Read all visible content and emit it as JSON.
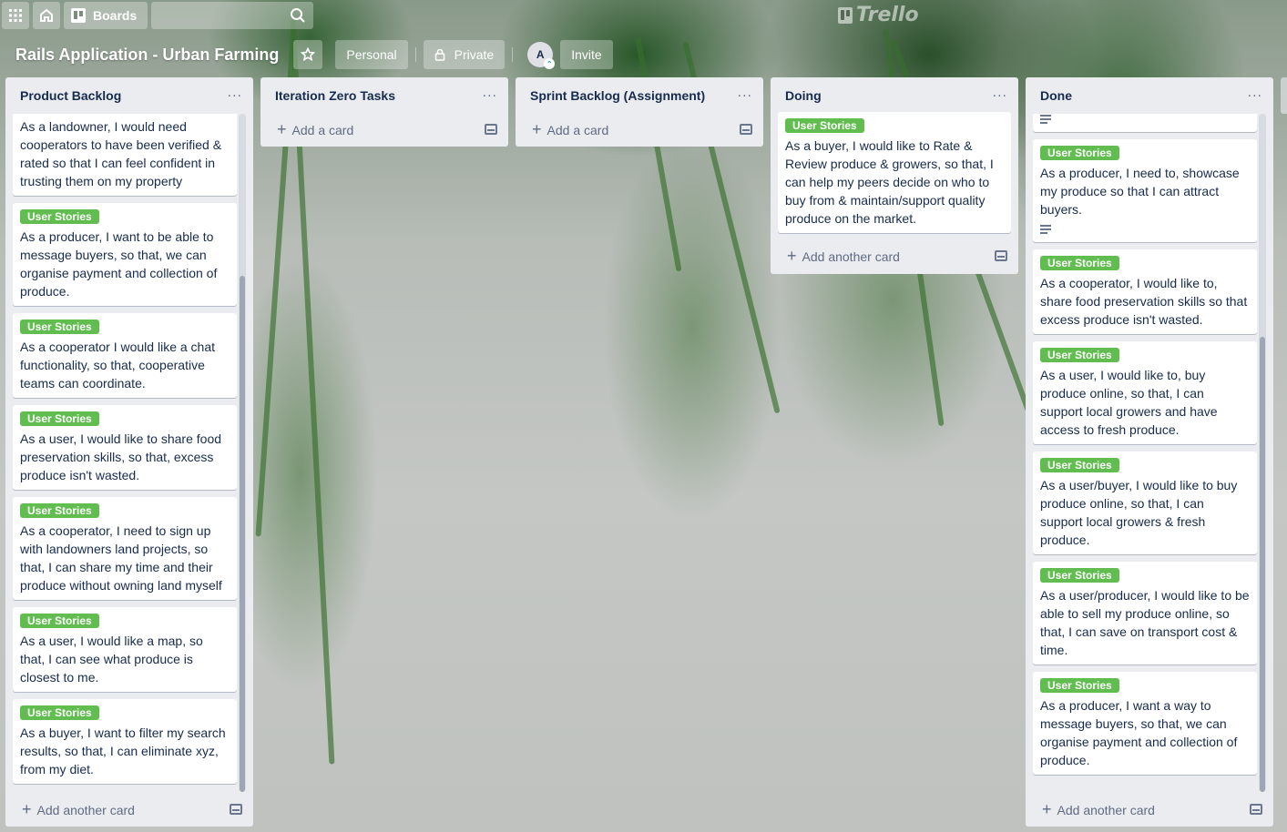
{
  "app": {
    "logo": "Trello"
  },
  "topbar": {
    "boards_label": "Boards",
    "search_placeholder": ""
  },
  "board": {
    "title": "Rails Application - Urban Farming",
    "team_label": "Personal",
    "visibility_label": "Private",
    "member_initial": "A",
    "invite_label": "Invite"
  },
  "colors": {
    "label_green": "#61bd4f",
    "list_bg": "#ebecf0"
  },
  "lists": [
    {
      "title": "Product Backlog",
      "add_label": "Add another card",
      "cards": [
        {
          "label": "",
          "text": "As a landowner, I would need cooperators to have been verified & rated so that I can feel confident in trusting them on my property"
        },
        {
          "label": "User Stories",
          "text": "As a producer, I want to be able to message buyers, so that, we can organise payment and collection of produce."
        },
        {
          "label": "User Stories",
          "text": "As a cooperator I would like a chat functionality, so that, cooperative teams can coordinate."
        },
        {
          "label": "User Stories",
          "text": "As a user, I would like to share food preservation skills, so that, excess produce isn't wasted."
        },
        {
          "label": "User Stories",
          "text": "As a cooperator, I need to sign up with landowners land projects, so that, I can share my time and their produce without owning land myself"
        },
        {
          "label": "User Stories",
          "text": "As a user, I would like a map, so that, I can see what produce is closest to me."
        },
        {
          "label": "User Stories",
          "text": "As a buyer, I want to filter my search results, so that, I can eliminate xyz, from my diet."
        }
      ]
    },
    {
      "title": "Iteration Zero Tasks",
      "add_label": "Add a card",
      "cards": []
    },
    {
      "title": "Sprint Backlog (Assignment)",
      "add_label": "Add a card",
      "cards": []
    },
    {
      "title": "Doing",
      "add_label": "Add another card",
      "cards": [
        {
          "label": "User Stories",
          "text": "As a buyer, I would like to Rate & Review produce & growers, so that, I can help my peers decide on who to buy from & maintain/support quality produce on the market."
        }
      ]
    },
    {
      "title": "Done",
      "add_label": "Add another card",
      "cards": [
        {
          "label": "User Stories",
          "text": "As a producer, I need to, showcase my produce so that I can attract buyers.",
          "has_description": true
        },
        {
          "label": "User Stories",
          "text": "As a cooperator, I would like to, share food preservation skills so that excess produce isn't wasted."
        },
        {
          "label": "User Stories",
          "text": "As a user, I would like to, buy produce online, so that, I can support local growers and have access to fresh produce."
        },
        {
          "label": "User Stories",
          "text": "As a user/buyer, I would like to buy produce online, so that, I can support local growers & fresh produce."
        },
        {
          "label": "User Stories",
          "text": "As a user/producer, I would like to be able to sell my produce online, so that, I can save on transport cost & time."
        },
        {
          "label": "User Stories",
          "text": "As a producer, I want a way to message buyers, so that, we can organise payment and collection of produce."
        }
      ]
    }
  ]
}
